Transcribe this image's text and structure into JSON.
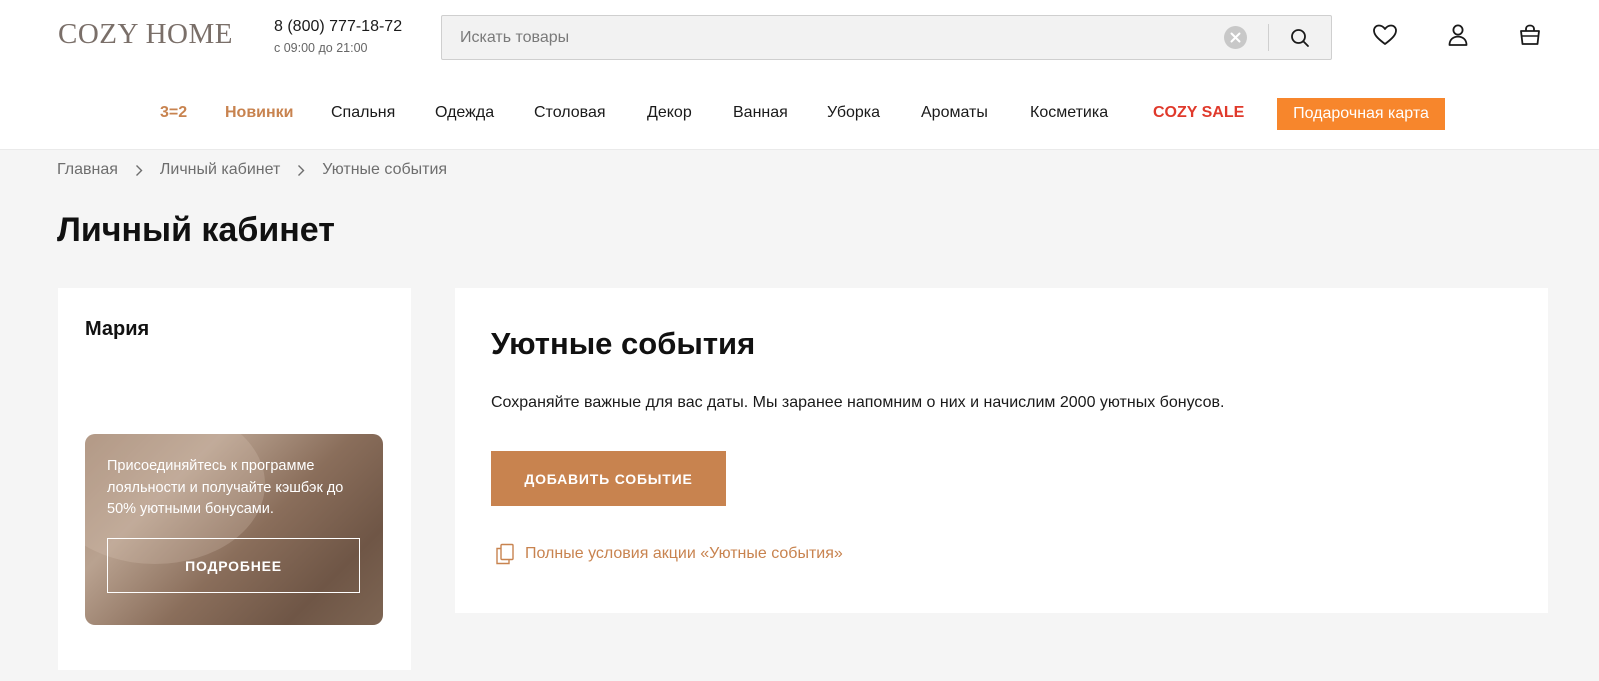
{
  "header": {
    "logo": "COZY HOME",
    "phone": "8 (800) 777-18-72",
    "hours": "с 09:00 до 21:00",
    "search": {
      "placeholder": "Искать товары",
      "value": ""
    },
    "icons": [
      "clear-icon",
      "search-icon",
      "heart-icon",
      "user-icon",
      "shopping-bag-icon"
    ]
  },
  "nav": {
    "items": [
      {
        "label": "3=2",
        "style": "brand"
      },
      {
        "label": "Новинки",
        "style": "brand"
      },
      {
        "label": "Спальня"
      },
      {
        "label": "Одежда"
      },
      {
        "label": "Столовая"
      },
      {
        "label": "Декор"
      },
      {
        "label": "Ванная"
      },
      {
        "label": "Уборка"
      },
      {
        "label": "Ароматы"
      },
      {
        "label": "Косметика"
      },
      {
        "label": "COZY SALE",
        "style": "sale"
      }
    ],
    "gift_card": "Подарочная карта"
  },
  "breadcrumb": [
    "Главная",
    "Личный кабинет",
    "Уютные события"
  ],
  "page_title": "Личный кабинет",
  "sidebar": {
    "user_name": "Мария",
    "promo": {
      "text": "Присоединяйтесь к программе лояльности и получайте кэшбэк до 50% уютными бонусами.",
      "button": "ПОДРОБНЕЕ"
    }
  },
  "main": {
    "title": "Уютные события",
    "description": "Сохраняйте важные для вас даты. Мы заранее напомним о них и начислим 2000 уютных бонусов.",
    "add_button": "ДОБАВИТЬ СОБЫТИЕ",
    "terms_link": "Полные условия акции «Уютные события»"
  },
  "colors": {
    "accent": "#c8834f",
    "sale": "#e0392b",
    "gift": "#f7862c",
    "background": "#f5f5f5"
  }
}
